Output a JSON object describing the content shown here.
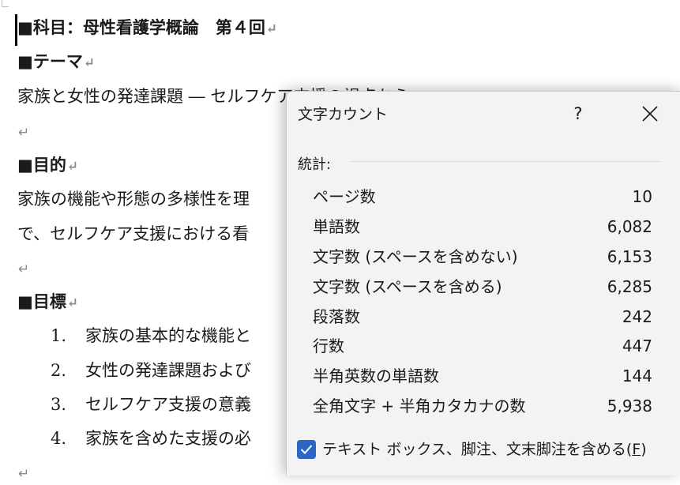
{
  "document": {
    "heading_subject": "■科目：母性看護学概論　第４回",
    "heading_theme": "■テーマ",
    "theme_text": "家族と女性の発達課題 ― セルフケア支援の視点から",
    "heading_purpose": "■目的",
    "purpose_line1": "家族の機能や形態の多様性を理",
    "purpose_line2": "で、セルフケア支援における看",
    "heading_goals": "■目標",
    "goals": [
      {
        "num": "1.",
        "text": "家族の基本的な機能と"
      },
      {
        "num": "2.",
        "text": "女性の発達課題および"
      },
      {
        "num": "3.",
        "text": "セルフケア支援の意義"
      },
      {
        "num": "4.",
        "text": "家族を含めた支援の必"
      }
    ],
    "paragraph_mark": "↵"
  },
  "dialog": {
    "title": "文字カウント",
    "help_label": "?",
    "section_label": "統計:",
    "stats": [
      {
        "label": "ページ数",
        "value": "10"
      },
      {
        "label": "単語数",
        "value": "6,082"
      },
      {
        "label": "文字数 (スペースを含めない)",
        "value": "6,153"
      },
      {
        "label": "文字数 (スペースを含める)",
        "value": "6,285"
      },
      {
        "label": "段落数",
        "value": "242"
      },
      {
        "label": "行数",
        "value": "447"
      },
      {
        "label": "半角英数の単語数",
        "value": "144"
      },
      {
        "label": "全角文字 + 半角カタカナの数",
        "value": "5,938"
      }
    ],
    "checkbox": {
      "label": "テキスト ボックス、脚注、文末脚注を含める(",
      "accelerator": "F",
      "label_end": ")",
      "checked": true
    },
    "accent_color": "#2b66c4"
  }
}
